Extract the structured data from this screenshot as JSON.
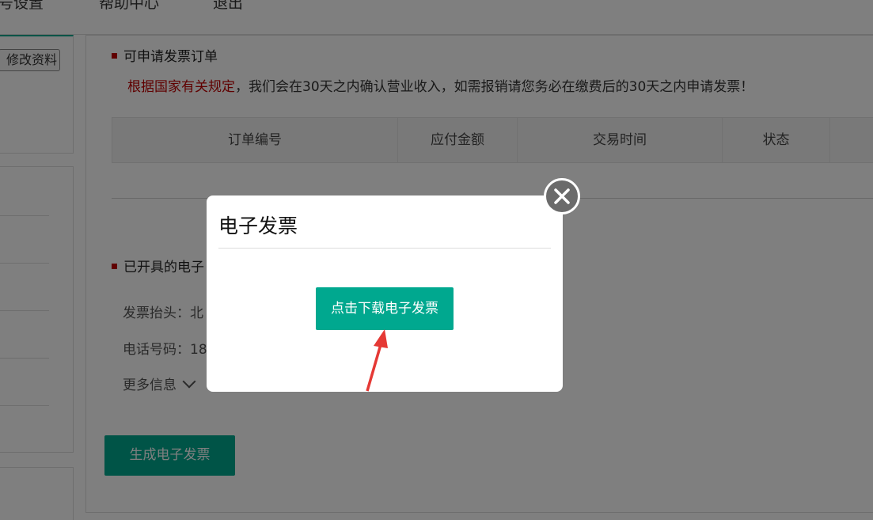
{
  "topnav": {
    "items": [
      "号设置",
      "帮助中心",
      "退出"
    ]
  },
  "sidebar": {
    "edit_profile_label": "修改资料"
  },
  "orders_section": {
    "title": "可申请发票订单",
    "notice_red": "根据国家有关规定",
    "notice_rest": "，我们会在30天之内确认营业收入，如需报销请您务必在缴费后的30天之内申请发票！",
    "columns": [
      "订单编号",
      "应付金额",
      "交易时间",
      "状态"
    ]
  },
  "issued_section": {
    "title": "已开具的电子",
    "invoice_title_label": "发票抬头：北",
    "phone_label": "电话号码：18",
    "more_info_label": "更多信息"
  },
  "generate_button_label": "生成电子发票",
  "modal": {
    "title": "电子发票",
    "download_button_label": "点击下载电子发票"
  },
  "colors": {
    "accent": "#00a88f",
    "notice_red": "#c00000",
    "annotation_arrow": "#e53935"
  },
  "icons": {
    "close": "close-circle-icon",
    "section_marker": "red-square-icon",
    "more": "chevron-down-icon"
  }
}
